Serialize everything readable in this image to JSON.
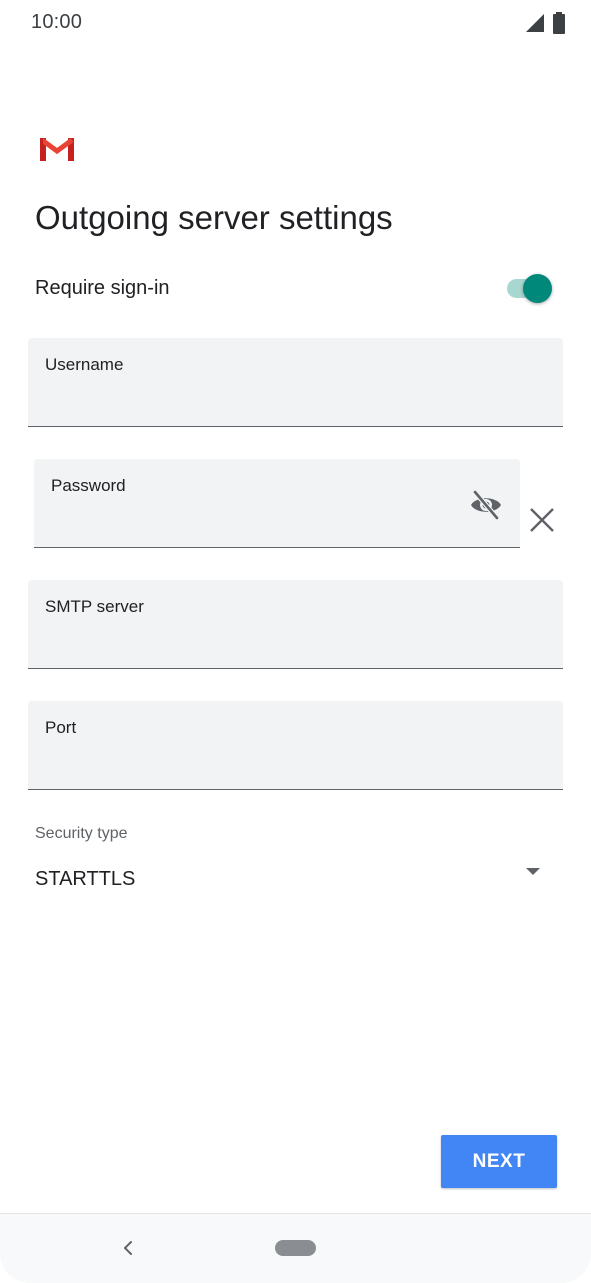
{
  "status_bar": {
    "time": "10:00",
    "icons": [
      "signal-icon",
      "battery-icon"
    ]
  },
  "app": {
    "logo": "gmail-logo"
  },
  "page": {
    "title": "Outgoing server settings"
  },
  "require_signin": {
    "label": "Require sign-in",
    "enabled": true,
    "accent_color": "#00897b"
  },
  "fields": {
    "username": {
      "label": "Username",
      "value": ""
    },
    "password": {
      "label": "Password",
      "value": "",
      "visibility_icon": "eye-off-icon",
      "clear_icon": "close-icon"
    },
    "smtp_server": {
      "label": "SMTP server",
      "value": ""
    },
    "port": {
      "label": "Port",
      "value": ""
    }
  },
  "security": {
    "label": "Security type",
    "selected": "STARTTLS",
    "icon": "dropdown-arrow-icon"
  },
  "actions": {
    "next_label": "NEXT",
    "next_color": "#4285f4"
  },
  "nav_bar": {
    "icons": [
      "back-icon",
      "home-pill"
    ]
  }
}
